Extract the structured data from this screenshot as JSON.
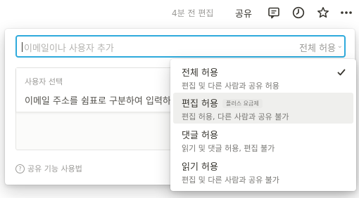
{
  "topbar": {
    "edited_text": "4분 전 편집",
    "share_label": "공유",
    "icons": [
      "comment-icon",
      "clock-icon",
      "star-icon",
      "more-icon"
    ]
  },
  "invite": {
    "placeholder": "이메일이나 사용자 추가",
    "permission_label": "전체 허용"
  },
  "suggestion": {
    "title": "사용자 선택",
    "hint": "이메일 주소를 쉼표로 구분하여 입력하세요"
  },
  "help": {
    "label": "공유 기능 사용법"
  },
  "permission_menu": {
    "items": [
      {
        "title": "전체 허용",
        "desc": "편집 및 다른 사람과 공유 허용",
        "selected": true
      },
      {
        "title": "편집 허용",
        "badge": "플러스 요금제",
        "desc": "편집 허용, 다른 사람과 공유 불가",
        "highlighted": true
      },
      {
        "title": "댓글 허용",
        "desc": "읽기 및 댓글 허용, 편집 불가"
      },
      {
        "title": "읽기 허용",
        "desc": "편집 및 다른 사람과 공유 불가"
      }
    ]
  },
  "colors": {
    "focus_border": "#2eaadc",
    "highlight": "#efefed",
    "text": "#37352f",
    "muted": "#9b9a97"
  }
}
